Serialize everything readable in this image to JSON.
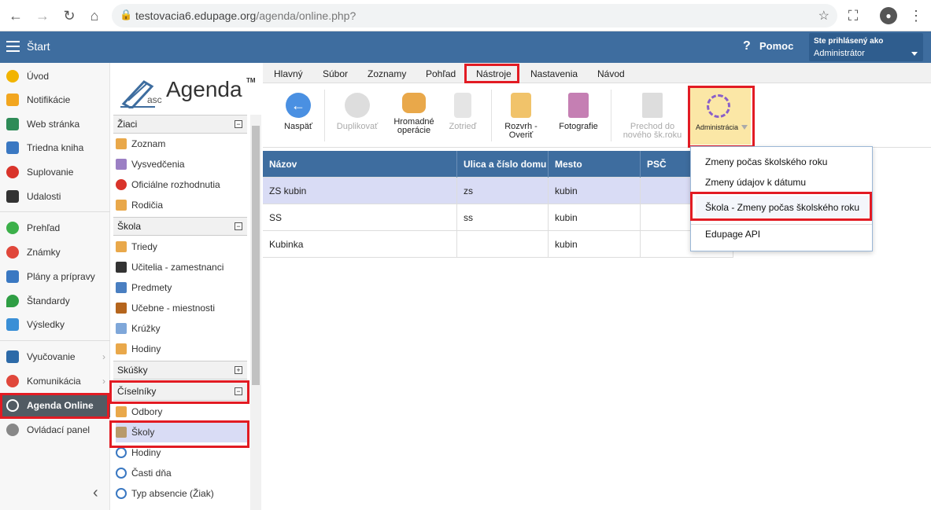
{
  "browser": {
    "url_host": "testovacia6.edupage.org",
    "url_path": "/agenda/online.php?"
  },
  "header": {
    "start_label": "Štart",
    "help_label": "Pomoc",
    "logged_as_label": "Ste prihlásený ako",
    "user_role": "Administrátor"
  },
  "sidebar": {
    "items": [
      {
        "label": "Úvod",
        "color": "#f2b400"
      },
      {
        "label": "Notifikácie",
        "color": "#f2a61f"
      },
      {
        "label": "Web stránka",
        "color": "#2e8b57"
      },
      {
        "label": "Triedna kniha",
        "color": "#3a78c2"
      },
      {
        "label": "Suplovanie",
        "color": "#d9342b"
      },
      {
        "label": "Udalosti",
        "color": "#333333"
      },
      {
        "label": "Prehľad",
        "color": "#3cb04a"
      },
      {
        "label": "Známky",
        "color": "#e0473b"
      },
      {
        "label": "Plány a prípravy",
        "color": "#3a78c2"
      },
      {
        "label": "Štandardy",
        "color": "#2f9e44"
      },
      {
        "label": "Výsledky",
        "color": "#3a8fd6"
      },
      {
        "label": "Vyučovanie",
        "color": "#2d6aa8"
      },
      {
        "label": "Komunikácia",
        "color": "#e0473b"
      },
      {
        "label": "Agenda Online",
        "color": "#ffffff"
      },
      {
        "label": "Ovládací panel",
        "color": "#888888"
      }
    ]
  },
  "logo": {
    "prefix": "asc",
    "name": "Agenda",
    "tm": "TM"
  },
  "middle": {
    "sections": [
      {
        "title": "Žiaci",
        "toggle": "−"
      },
      {
        "title": "Škola",
        "toggle": "−"
      },
      {
        "title": "Skúšky",
        "toggle": "+"
      },
      {
        "title": "Číselníky",
        "toggle": "−"
      }
    ],
    "items": [
      "Zoznam",
      "Vysvedčenia",
      "Oficiálne rozhodnutia",
      "Rodičia",
      "Triedy",
      "Učitelia - zamestnanci",
      "Predmety",
      "Učebne - miestnosti",
      "Krúžky",
      "Hodiny",
      "Odbory",
      "Školy",
      "Hodiny",
      "Časti dňa",
      "Typ absencie (Žiak)"
    ]
  },
  "menubar": [
    "Hlavný",
    "Súbor",
    "Zoznamy",
    "Pohľad",
    "Nástroje",
    "Nastavenia",
    "Návod"
  ],
  "toolbar": {
    "back": "Naspäť",
    "duplicate": "Duplikovať",
    "bulk1": "Hromadné",
    "bulk2": "operácie",
    "sort": "Zotrieď",
    "schedule1": "Rozvrh -",
    "schedule2": "Overiť",
    "photos": "Fotografie",
    "transition1": "Prechod do",
    "transition2": "nového šk.roku",
    "admin": "Administrácia"
  },
  "table": {
    "headers": [
      "Názov",
      "Ulica a číslo domu",
      "Mesto",
      "PSČ"
    ],
    "rows": [
      [
        "ZS kubin",
        "zs",
        "kubin",
        ""
      ],
      [
        "SS",
        "ss",
        "kubin",
        ""
      ],
      [
        "Kubinka",
        "",
        "kubin",
        ""
      ]
    ]
  },
  "dropdown": {
    "items": [
      "Zmeny počas školského roku",
      "Zmeny údajov k dátumu",
      "Škola - Zmeny počas školského roku",
      "Edupage API"
    ]
  },
  "colors": {
    "header_blue": "#3e6d9f",
    "highlight_red": "#e21b23",
    "selected_row": "#d9dcf5",
    "active_sidebar": "#515b63"
  }
}
